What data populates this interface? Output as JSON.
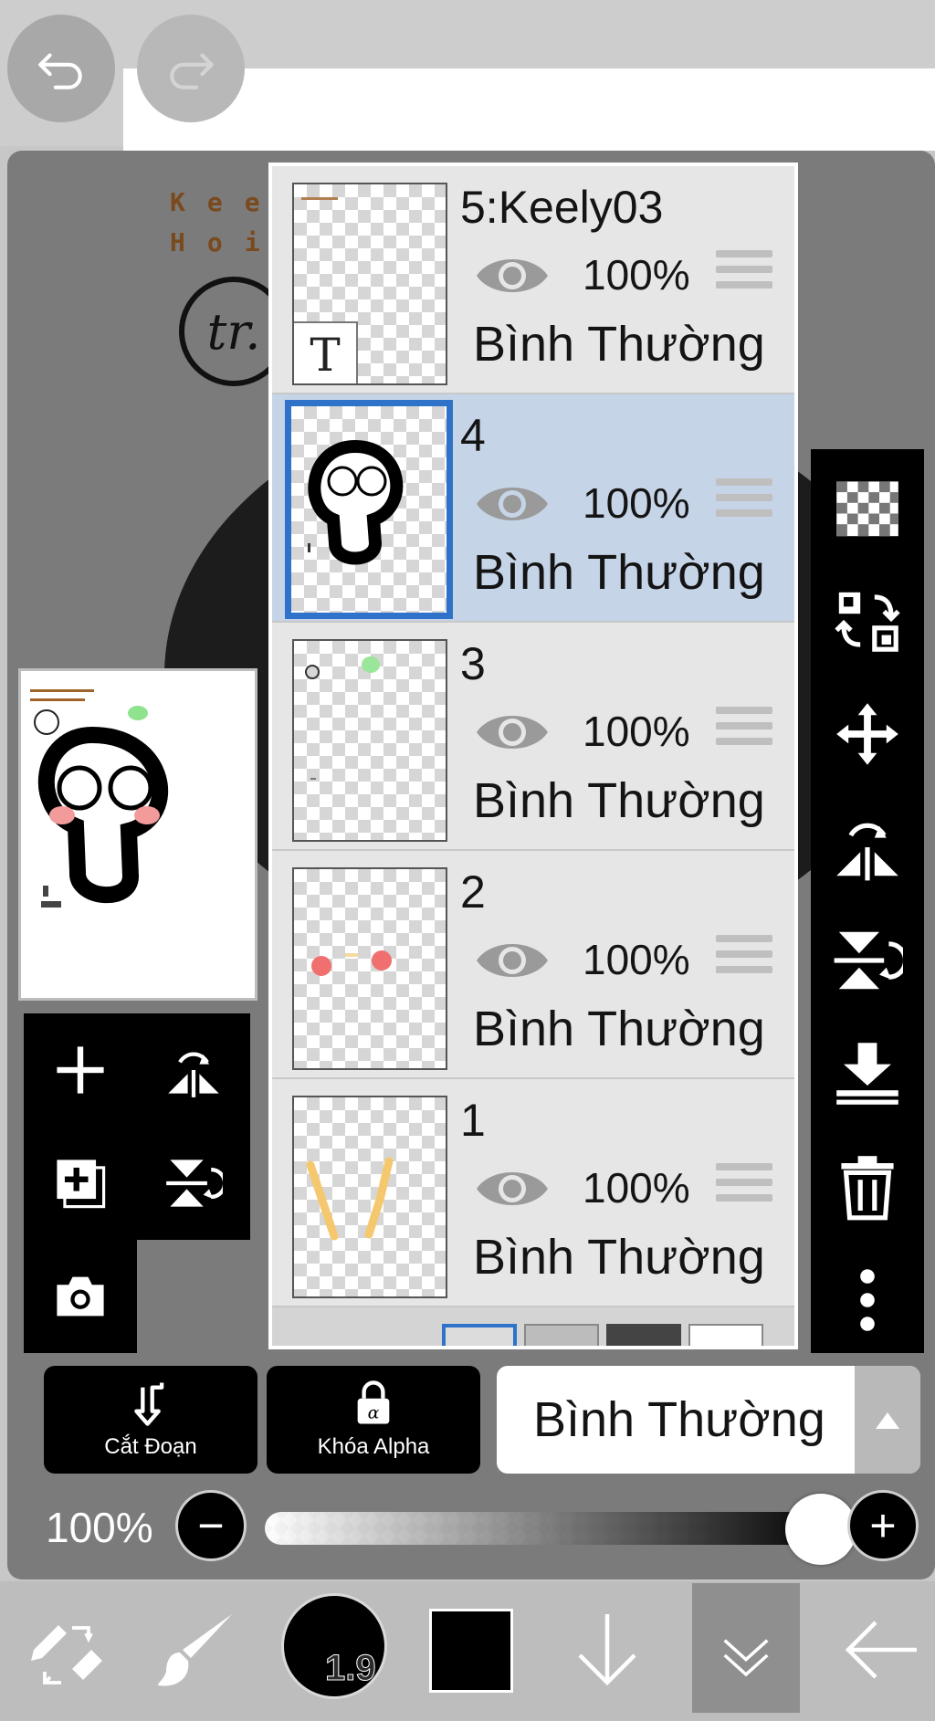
{
  "history": {
    "undo_icon": "undo-icon",
    "redo_icon": "redo-icon"
  },
  "canvas_art": {
    "line1": "Kee",
    "line2": "Hoi",
    "badge": "tr."
  },
  "layers": [
    {
      "name": "5:Keely03",
      "opacity": "100%",
      "blend": "Bình Thường",
      "selected": false,
      "thumb_glyph": "T"
    },
    {
      "name": "4",
      "opacity": "100%",
      "blend": "Bình Thường",
      "selected": true
    },
    {
      "name": "3",
      "opacity": "100%",
      "blend": "Bình Thường",
      "selected": false
    },
    {
      "name": "2",
      "opacity": "100%",
      "blend": "Bình Thường",
      "selected": false
    },
    {
      "name": "1",
      "opacity": "100%",
      "blend": "Bình Thường",
      "selected": false
    }
  ],
  "right_toolbar": [
    "transparent-checker-icon",
    "swap-layers-icon",
    "move-icon",
    "flip-horizontal-icon",
    "flip-vertical-icon",
    "merge-down-icon",
    "trash-icon",
    "more-vertical-icon"
  ],
  "left_toolbar": [
    "add-layer-icon",
    "flip-horizontal-icon",
    "duplicate-layer-icon",
    "flip-vertical-icon",
    "camera-icon"
  ],
  "actions": {
    "clipping_label": "Cắt Đoạn",
    "alpha_lock_label": "Khóa Alpha"
  },
  "blend_mode": {
    "selected": "Bình Thường"
  },
  "opacity": {
    "label": "100%",
    "minus": "−",
    "plus": "+",
    "level": 1.0
  },
  "bottom_toolbar": {
    "brush_size": "1.9",
    "color": "#000000"
  },
  "colors": {
    "selection_blue": "#2e73c9",
    "selected_row_bg": "#c6d4e8",
    "row_bg": "#e6e6e6"
  }
}
